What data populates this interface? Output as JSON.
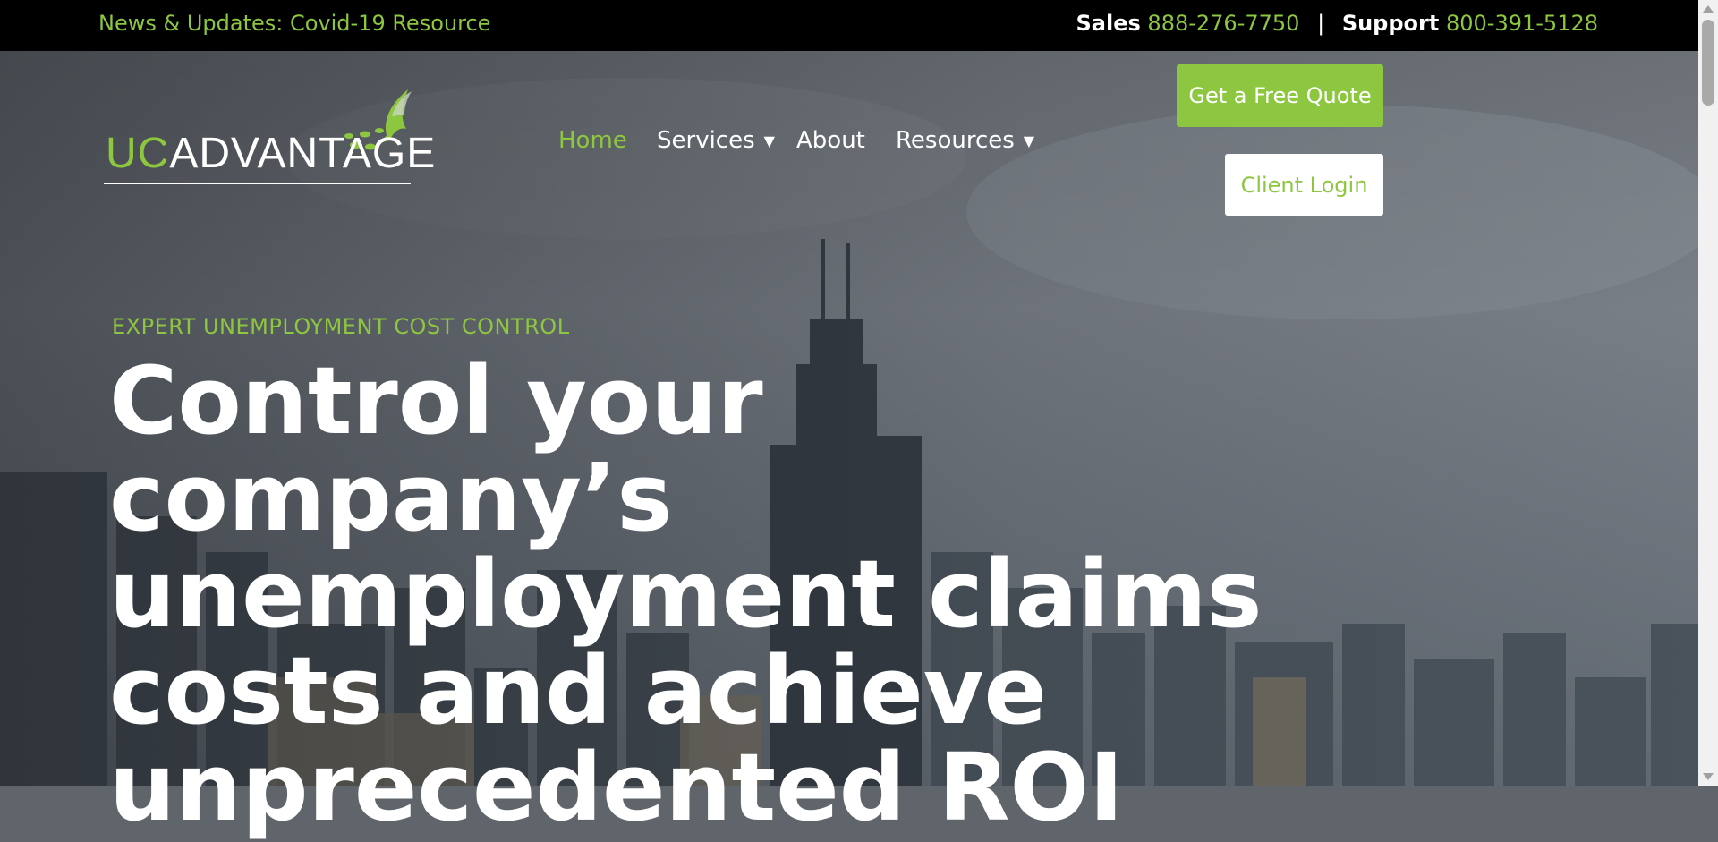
{
  "topbar": {
    "news_link": "News & Updates: Covid-19 Resource",
    "sales_label": "Sales",
    "sales_phone": "888-276-7750",
    "separator": "|",
    "support_label": "Support",
    "support_phone": "800-391-5128"
  },
  "logo": {
    "uc": "UC",
    "advantage": "ADVANTAGE",
    "icon": "hummingbird-icon"
  },
  "nav": {
    "items": [
      {
        "label": "Home",
        "active": true
      },
      {
        "label": "Services",
        "has_dropdown": true
      },
      {
        "label": "About"
      },
      {
        "label": "Resources",
        "has_dropdown": true
      }
    ],
    "caret_icon": "chevron-down-icon"
  },
  "buttons": {
    "quote": "Get a Free Quote",
    "login": "Client Login"
  },
  "hero": {
    "eyebrow": "EXPERT UNEMPLOYMENT COST CONTROL",
    "headline": "Control your company’s unemployment claims costs and achieve unprecedented ROI"
  },
  "colors": {
    "accent": "#8dc63f",
    "topbar_bg": "#000000"
  }
}
